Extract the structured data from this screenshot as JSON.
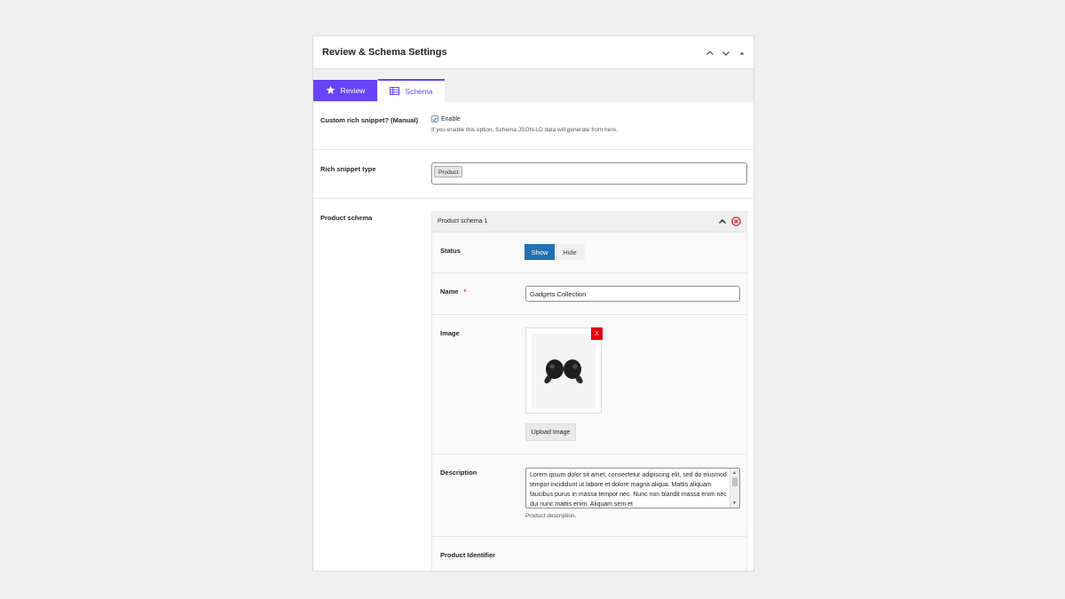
{
  "panel": {
    "title": "Review & Schema Settings",
    "controls": [
      "chevron-up-icon",
      "chevron-down-icon",
      "caret-up-icon"
    ]
  },
  "tabs": [
    {
      "label": "Review",
      "icon": "star-icon",
      "active": true
    },
    {
      "label": "Schema",
      "icon": "table-icon",
      "active": false
    }
  ],
  "fields": {
    "custom_snippet": {
      "label": "Custom rich snippet? (Manual)",
      "checkbox_label": "Enable",
      "checked": true,
      "help": "If you enable this option, Schema JSON-LD data will generate from here."
    },
    "snippet_type": {
      "label": "Rich snippet type",
      "selected": "Product"
    },
    "product_schema": {
      "label": "Product schema",
      "item_title": "Product schema 1",
      "status": {
        "label": "Status",
        "options": [
          "Show",
          "Hide"
        ],
        "selected": "Show"
      },
      "name": {
        "label": "Name",
        "required_mark": "*",
        "value": "Gadgets Collection"
      },
      "image": {
        "label": "Image",
        "remove_label": "X",
        "upload_label": "Upload Image"
      },
      "description": {
        "label": "Description",
        "value": "Lorem ipsum dolor sit amet, consectetur adipiscing elit, sed do eiusmod tempor incididunt ut labore et dolore magna aliqua. Mattis aliquam faucibus purus in massa tempor nec. Nunc non blandit massa enim nec dui nunc mattis enim. Aliquam sem et",
        "help": "Product description."
      },
      "identifier": {
        "label": "Product Identifier"
      }
    }
  },
  "colors": {
    "accent": "#6743fa",
    "primary_button": "#2271b1",
    "danger": "#e3000f",
    "required": "#d63638",
    "page_bg": "#f0f0f1"
  }
}
